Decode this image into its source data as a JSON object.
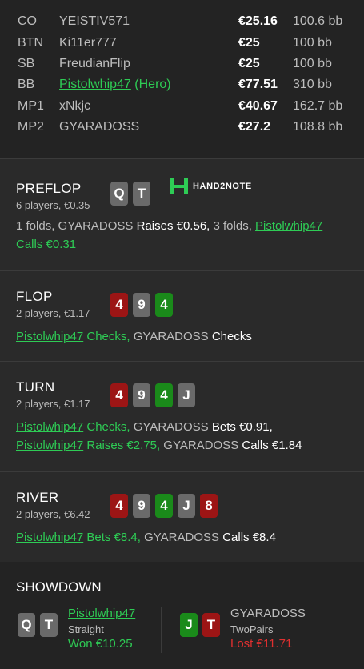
{
  "players": [
    {
      "pos": "CO",
      "name": "YEISTIV571",
      "stack": "€25.16",
      "bb": "100.6 bb",
      "hero": false
    },
    {
      "pos": "BTN",
      "name": "Ki11er777",
      "stack": "€25",
      "bb": "100 bb",
      "hero": false
    },
    {
      "pos": "SB",
      "name": "FreudianFlip",
      "stack": "€25",
      "bb": "100 bb",
      "hero": false
    },
    {
      "pos": "BB",
      "name": "Pistolwhip47",
      "tag": "(Hero)",
      "stack": "€77.51",
      "bb": "310 bb",
      "hero": true
    },
    {
      "pos": "MP1",
      "name": "xNkjc",
      "stack": "€40.67",
      "bb": "162.7 bb",
      "hero": false
    },
    {
      "pos": "MP2",
      "name": "GYARADOSS",
      "stack": "€27.2",
      "bb": "108.8 bb",
      "hero": false
    }
  ],
  "preflop": {
    "title": "PREFLOP",
    "sub": "6 players, €0.35",
    "cards": [
      {
        "rank": "Q",
        "color": "grey"
      },
      {
        "rank": "T",
        "color": "grey"
      }
    ],
    "logo_text": "HAND2NOTE",
    "a1": "1 folds, GYARADOSS ",
    "a2": "Raises €0.56, ",
    "a3": "3 folds, ",
    "a4": "Pistolwhip47",
    "a5": "Calls €0.31"
  },
  "flop": {
    "title": "FLOP",
    "sub": "2 players, €1.17",
    "cards": [
      {
        "rank": "4",
        "color": "red"
      },
      {
        "rank": "9",
        "color": "grey"
      },
      {
        "rank": "4",
        "color": "green"
      }
    ],
    "a1": "Pistolwhip47",
    "a2": " Checks, ",
    "a3": "GYARADOSS ",
    "a4": "Checks"
  },
  "turn": {
    "title": "TURN",
    "sub": "2 players, €1.17",
    "cards": [
      {
        "rank": "4",
        "color": "red"
      },
      {
        "rank": "9",
        "color": "grey"
      },
      {
        "rank": "4",
        "color": "green"
      },
      {
        "rank": "J",
        "color": "grey"
      }
    ],
    "a1": "Pistolwhip47",
    "a2": " Checks, ",
    "a3": "GYARADOSS ",
    "a4": "Bets €0.91,",
    "a5": "Pistolwhip47",
    "a6": " Raises €2.75, ",
    "a7": "GYARADOSS ",
    "a8": "Calls €1.84"
  },
  "river": {
    "title": "RIVER",
    "sub": "2 players, €6.42",
    "cards": [
      {
        "rank": "4",
        "color": "red"
      },
      {
        "rank": "9",
        "color": "grey"
      },
      {
        "rank": "4",
        "color": "green"
      },
      {
        "rank": "J",
        "color": "grey"
      },
      {
        "rank": "8",
        "color": "red"
      }
    ],
    "a1": "Pistolwhip47",
    "a2": " Bets €8.4, ",
    "a3": "GYARADOSS ",
    "a4": "Calls €8.4"
  },
  "showdown": {
    "title": "SHOWDOWN",
    "hero": {
      "cards": [
        {
          "rank": "Q",
          "color": "grey"
        },
        {
          "rank": "T",
          "color": "grey"
        }
      ],
      "name": "Pistolwhip47",
      "hand": "Straight",
      "result": "Won €10.25"
    },
    "villain": {
      "cards": [
        {
          "rank": "J",
          "color": "green"
        },
        {
          "rank": "T",
          "color": "red"
        }
      ],
      "name": "GYARADOSS",
      "hand": "TwoPairs",
      "result": "Lost €11.71"
    }
  },
  "colors": {
    "hero": "#2ecc55",
    "lost": "#e03030",
    "red_card": "#9c1515",
    "green_card": "#1a8a1a",
    "grey_card": "#6a6a6a"
  }
}
